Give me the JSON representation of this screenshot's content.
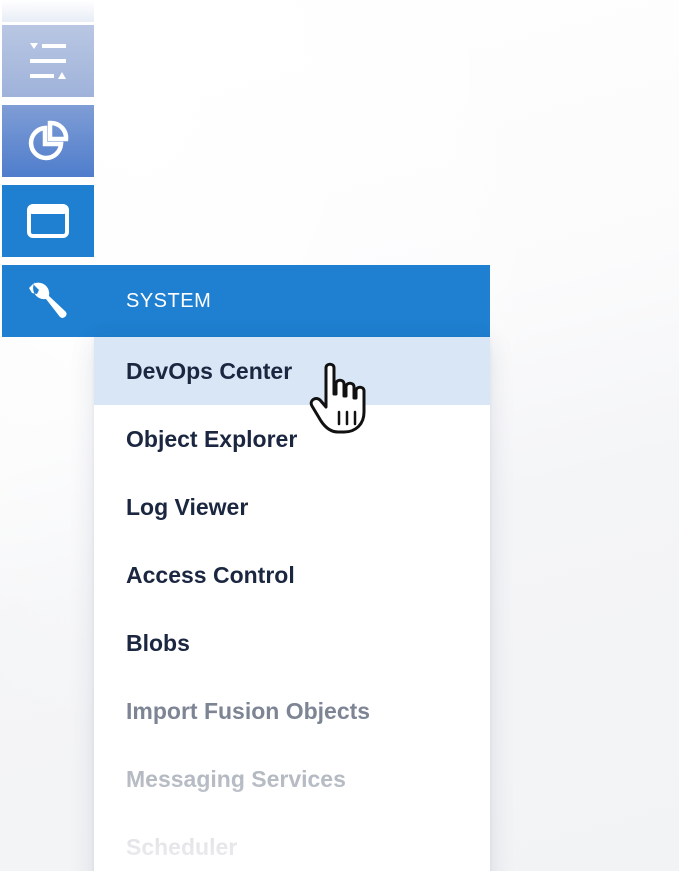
{
  "colors": {
    "accent": "#1f7fd0",
    "hover": "#d9e6f6",
    "text": "#1b2740",
    "text_dim": "#7d8594"
  },
  "rail": {
    "items": [
      {
        "icon": "filter-sliders-icon"
      },
      {
        "icon": "pie-chart-icon"
      },
      {
        "icon": "window-icon"
      }
    ]
  },
  "system": {
    "icon": "wrench-icon",
    "label": "SYSTEM"
  },
  "menu": {
    "items": [
      {
        "label": "DevOps Center"
      },
      {
        "label": "Object Explorer"
      },
      {
        "label": "Log Viewer"
      },
      {
        "label": "Access Control"
      },
      {
        "label": "Blobs"
      },
      {
        "label": "Import Fusion Objects"
      },
      {
        "label": "Messaging Services"
      },
      {
        "label": "Scheduler"
      }
    ]
  },
  "cursor": {
    "icon": "hand-pointer-icon"
  }
}
